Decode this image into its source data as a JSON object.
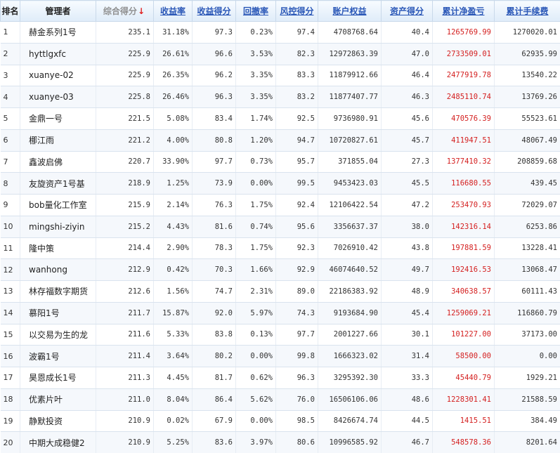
{
  "headers": {
    "rank": "排名",
    "manager": "管理者",
    "composite_score": "综合得分",
    "return_rate": "收益率",
    "return_score": "收益得分",
    "drawdown": "回撤率",
    "risk_score": "风控得分",
    "account_equity": "账户权益",
    "asset_score": "资产得分",
    "cumulative_pnl": "累计净盈亏",
    "cumulative_fees": "累计手续费"
  },
  "sort_arrow": "↓",
  "rows": [
    {
      "rank": "1",
      "manager": "赫金系列1号",
      "score": "235.1",
      "ret": "31.18%",
      "ret_score": "97.3",
      "dd": "0.23%",
      "risk": "97.4",
      "equity": "4708768.64",
      "asset": "40.4",
      "pnl": "1265769.99",
      "fee": "1270020.01"
    },
    {
      "rank": "2",
      "manager": "hyttlgxfc",
      "score": "225.9",
      "ret": "26.61%",
      "ret_score": "96.6",
      "dd": "3.53%",
      "risk": "82.3",
      "equity": "12972863.39",
      "asset": "47.0",
      "pnl": "2733509.01",
      "fee": "62935.99"
    },
    {
      "rank": "3",
      "manager": "xuanye-02",
      "score": "225.9",
      "ret": "26.35%",
      "ret_score": "96.2",
      "dd": "3.35%",
      "risk": "83.3",
      "equity": "11879912.66",
      "asset": "46.4",
      "pnl": "2477919.78",
      "fee": "13540.22"
    },
    {
      "rank": "4",
      "manager": "xuanye-03",
      "score": "225.8",
      "ret": "26.46%",
      "ret_score": "96.3",
      "dd": "3.35%",
      "risk": "83.2",
      "equity": "11877407.77",
      "asset": "46.3",
      "pnl": "2485110.74",
      "fee": "13769.26"
    },
    {
      "rank": "5",
      "manager": "金鼎一号",
      "score": "221.5",
      "ret": "5.08%",
      "ret_score": "83.4",
      "dd": "1.74%",
      "risk": "92.5",
      "equity": "9736980.91",
      "asset": "45.6",
      "pnl": "470576.39",
      "fee": "55523.61"
    },
    {
      "rank": "6",
      "manager": "梛江雨",
      "score": "221.2",
      "ret": "4.00%",
      "ret_score": "80.8",
      "dd": "1.20%",
      "risk": "94.7",
      "equity": "10720827.61",
      "asset": "45.7",
      "pnl": "411947.51",
      "fee": "48067.49"
    },
    {
      "rank": "7",
      "manager": "鑫波启佛",
      "score": "220.7",
      "ret": "33.90%",
      "ret_score": "97.7",
      "dd": "0.73%",
      "risk": "95.7",
      "equity": "371855.04",
      "asset": "27.3",
      "pnl": "1377410.32",
      "fee": "208859.68"
    },
    {
      "rank": "8",
      "manager": "友旋资产1号基",
      "score": "218.9",
      "ret": "1.25%",
      "ret_score": "73.9",
      "dd": "0.00%",
      "risk": "99.5",
      "equity": "9453423.03",
      "asset": "45.5",
      "pnl": "116680.55",
      "fee": "439.45"
    },
    {
      "rank": "9",
      "manager": "bob量化工作室",
      "score": "215.9",
      "ret": "2.14%",
      "ret_score": "76.3",
      "dd": "1.75%",
      "risk": "92.4",
      "equity": "12106422.54",
      "asset": "47.2",
      "pnl": "253470.93",
      "fee": "72029.07"
    },
    {
      "rank": "10",
      "manager": "mingshi-ziyin",
      "score": "215.2",
      "ret": "4.43%",
      "ret_score": "81.6",
      "dd": "0.74%",
      "risk": "95.6",
      "equity": "3356637.37",
      "asset": "38.0",
      "pnl": "142316.14",
      "fee": "6253.86"
    },
    {
      "rank": "11",
      "manager": "隆中策",
      "score": "214.4",
      "ret": "2.90%",
      "ret_score": "78.3",
      "dd": "1.75%",
      "risk": "92.3",
      "equity": "7026910.42",
      "asset": "43.8",
      "pnl": "197881.59",
      "fee": "13228.41"
    },
    {
      "rank": "12",
      "manager": "wanhong",
      "score": "212.9",
      "ret": "0.42%",
      "ret_score": "70.3",
      "dd": "1.66%",
      "risk": "92.9",
      "equity": "46074640.52",
      "asset": "49.7",
      "pnl": "192416.53",
      "fee": "13068.47"
    },
    {
      "rank": "13",
      "manager": "林存福数字期货",
      "score": "212.6",
      "ret": "1.56%",
      "ret_score": "74.7",
      "dd": "2.31%",
      "risk": "89.0",
      "equity": "22186383.92",
      "asset": "48.9",
      "pnl": "340638.57",
      "fee": "60111.43"
    },
    {
      "rank": "14",
      "manager": "慕阳1号",
      "score": "211.7",
      "ret": "15.87%",
      "ret_score": "92.0",
      "dd": "5.97%",
      "risk": "74.3",
      "equity": "9193684.90",
      "asset": "45.4",
      "pnl": "1259069.21",
      "fee": "116860.79"
    },
    {
      "rank": "15",
      "manager": "以交易为生的龙",
      "score": "211.6",
      "ret": "5.33%",
      "ret_score": "83.8",
      "dd": "0.13%",
      "risk": "97.7",
      "equity": "2001227.66",
      "asset": "30.1",
      "pnl": "101227.00",
      "fee": "37173.00"
    },
    {
      "rank": "16",
      "manager": "波霸1号",
      "score": "211.4",
      "ret": "3.64%",
      "ret_score": "80.2",
      "dd": "0.00%",
      "risk": "99.8",
      "equity": "1666323.02",
      "asset": "31.4",
      "pnl": "58500.00",
      "fee": "0.00"
    },
    {
      "rank": "17",
      "manager": "昊恩成长1号",
      "score": "211.3",
      "ret": "4.45%",
      "ret_score": "81.7",
      "dd": "0.62%",
      "risk": "96.3",
      "equity": "3295392.30",
      "asset": "33.3",
      "pnl": "45440.79",
      "fee": "1929.21"
    },
    {
      "rank": "18",
      "manager": "优素片叶",
      "score": "211.0",
      "ret": "8.04%",
      "ret_score": "86.4",
      "dd": "5.62%",
      "risk": "76.0",
      "equity": "16506106.06",
      "asset": "48.6",
      "pnl": "1228301.41",
      "fee": "21588.59"
    },
    {
      "rank": "19",
      "manager": "静默投资",
      "score": "210.9",
      "ret": "0.02%",
      "ret_score": "67.9",
      "dd": "0.00%",
      "risk": "98.5",
      "equity": "8426674.74",
      "asset": "44.5",
      "pnl": "1415.51",
      "fee": "384.49"
    },
    {
      "rank": "20",
      "manager": "中期大成稳健2",
      "score": "210.9",
      "ret": "5.25%",
      "ret_score": "83.6",
      "dd": "3.97%",
      "risk": "80.6",
      "equity": "10996585.92",
      "asset": "46.7",
      "pnl": "548578.36",
      "fee": "8201.64"
    }
  ],
  "colors": {
    "header_link": "#2a57b7",
    "header_sorted": "#8f8f8f",
    "sort_arrow": "#e02020",
    "pnl_text": "#d42020",
    "row_alt": "#f5f8fc",
    "grid_line": "#d9e3ee"
  }
}
